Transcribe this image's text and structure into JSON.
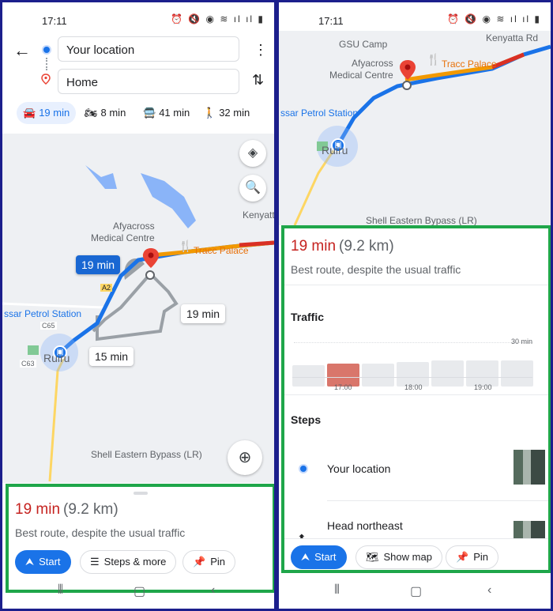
{
  "status": {
    "time": "17:11"
  },
  "left": {
    "origin_value": "Your location",
    "destination_value": "Home",
    "modes": [
      {
        "icon": "car-icon",
        "label": "19 min"
      },
      {
        "icon": "motorcycle-icon",
        "label": "8 min"
      },
      {
        "icon": "transit-icon",
        "label": "41 min"
      },
      {
        "icon": "walk-icon",
        "label": "32 min"
      }
    ],
    "map_labels": {
      "poi1": "Afyacross",
      "poi1b": "Medical Centre",
      "restaurant": "Tracc Palace",
      "kenyatta": "Kenyatt",
      "petrol": "ssar Petrol Station",
      "c65": "C65",
      "c63": "C63",
      "ruiru": "Ruiru",
      "shell": "Shell Eastern Bypass (LR)",
      "a2": "A2"
    },
    "eta_primary": "19 min",
    "eta_alt1": "19 min",
    "eta_alt2": "15 min",
    "sheet": {
      "duration": "19 min",
      "distance": "(9.2 km)",
      "summary": "Best route, despite the usual traffic",
      "start": "Start",
      "steps_more": "Steps & more",
      "pin": "Pin"
    }
  },
  "right": {
    "map_labels": {
      "gsu": "GSU Camp",
      "kenyatta_rd": "Kenyatta Rd",
      "poi1": "Afyacross",
      "poi1b": "Medical Centre",
      "restaurant": "Tracc Palace",
      "petrol": "ssar Petrol Station",
      "ruiru": "Ruiru",
      "shell": "Shell Eastern Bypass (LR)"
    },
    "sheet": {
      "duration": "19 min",
      "distance": "(9.2 km)",
      "summary": "Best route, despite the usual traffic",
      "traffic_title": "Traffic",
      "traffic_max": "30 min",
      "ticks": [
        "17:00",
        "18:00",
        "19:00"
      ],
      "steps_title": "Steps",
      "step1": "Your location",
      "step2": "Head northeast",
      "start": "Start",
      "show_map": "Show map",
      "pin": "Pin"
    },
    "traffic_bars": [
      0.45,
      0.48,
      0.48,
      0.52,
      0.55,
      0.55,
      0.55
    ]
  }
}
